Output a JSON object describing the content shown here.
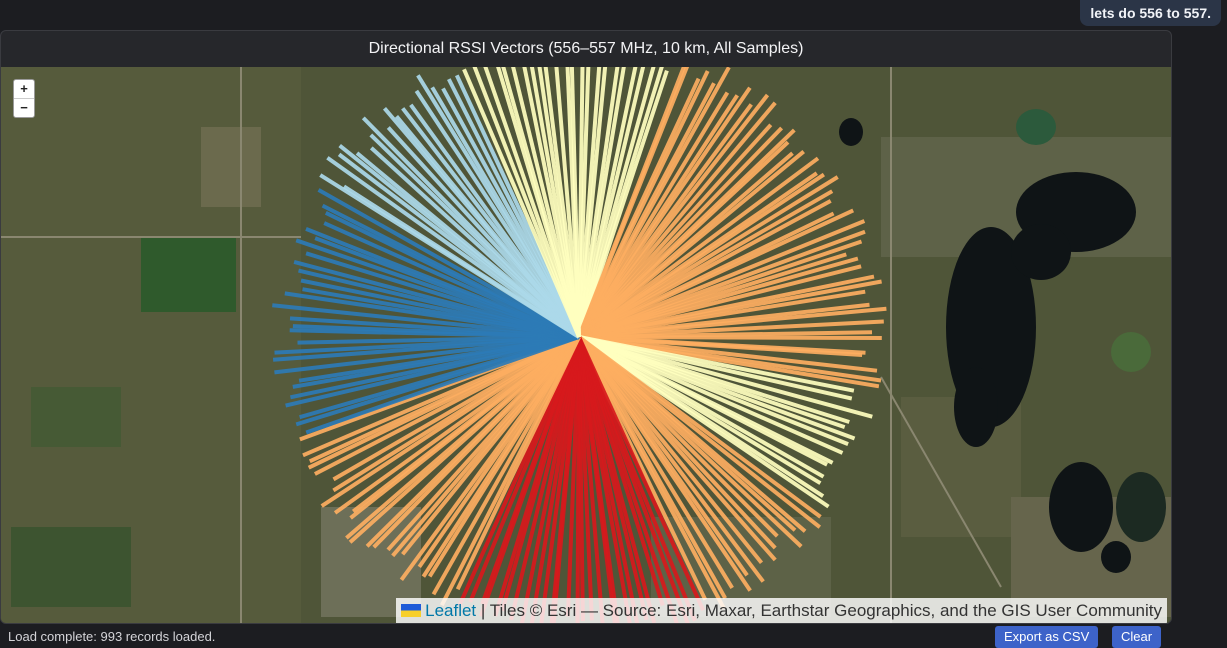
{
  "chat": {
    "message": "lets do 556 to 557."
  },
  "panel": {
    "title": "Directional RSSI Vectors (556–557 MHz, 10 km, All Samples)"
  },
  "map": {
    "zoom_in": "+",
    "zoom_out": "−",
    "attribution_link": "Leaflet",
    "attribution_text": " | Tiles © Esri — Source: Esri, Maxar, Earthstar Geographics, and the GIS User Community"
  },
  "footer": {
    "status": "Load complete: 993 records loaded.",
    "export_label": "Export as CSV",
    "clear_label": "Clear"
  },
  "colors": {
    "strong": "#d7191c",
    "medium_strong": "#fdae61",
    "neutral": "#ffffbf",
    "medium_weak": "#abd9e9",
    "weak": "#2c7bb6",
    "accent_button": "#3d63c9"
  }
}
